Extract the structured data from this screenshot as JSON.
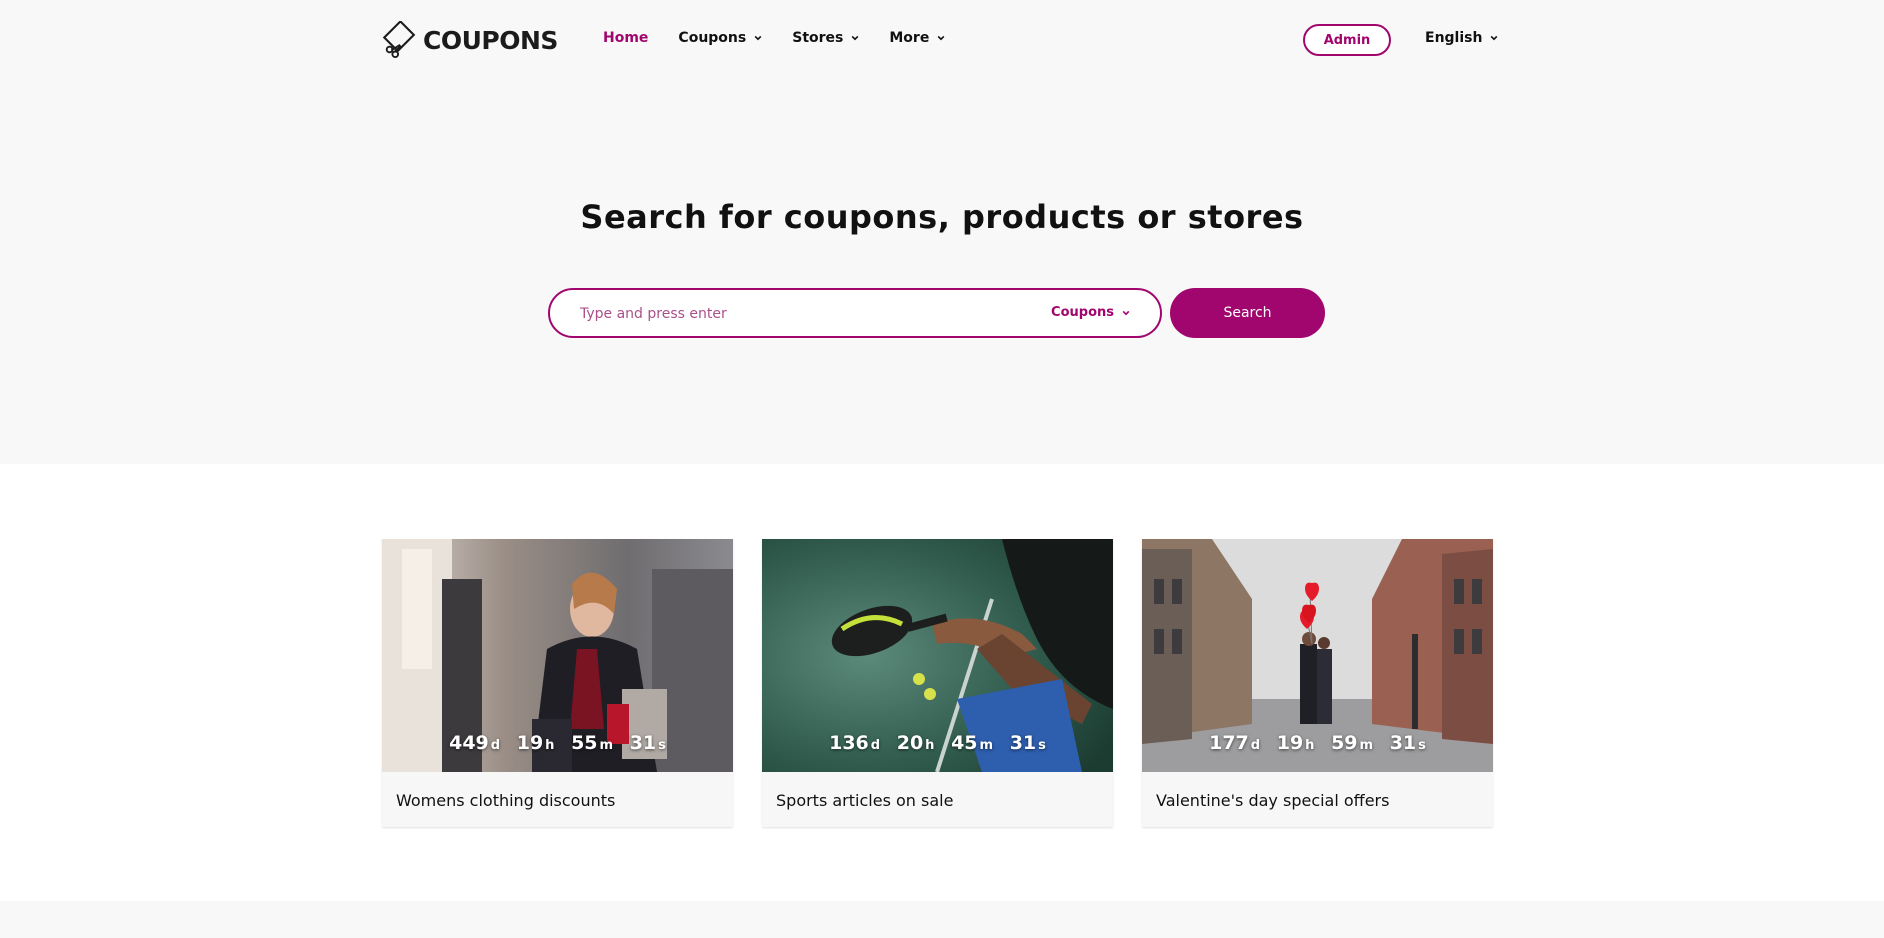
{
  "brand": {
    "name": "COUPONS",
    "accent": "#a0066e"
  },
  "nav": {
    "items": [
      {
        "label": "Home",
        "active": true,
        "has_dropdown": false
      },
      {
        "label": "Coupons",
        "active": false,
        "has_dropdown": true
      },
      {
        "label": "Stores",
        "active": false,
        "has_dropdown": true
      },
      {
        "label": "More",
        "active": false,
        "has_dropdown": true
      }
    ],
    "admin_label": "Admin",
    "language": "English"
  },
  "hero": {
    "title": "Search for coupons, products or stores",
    "search": {
      "placeholder": "Type and press enter",
      "type_selected": "Coupons",
      "button_label": "Search"
    }
  },
  "cards": [
    {
      "title": "Womens clothing discounts",
      "countdown": {
        "d": "449",
        "h": "19",
        "m": "55",
        "s": "31"
      },
      "image": "woman-shopping-photo"
    },
    {
      "title": "Sports articles on sale",
      "countdown": {
        "d": "136",
        "h": "20",
        "m": "45",
        "s": "31"
      },
      "image": "padel-racket-photo"
    },
    {
      "title": "Valentine's day special offers",
      "countdown": {
        "d": "177",
        "h": "19",
        "m": "59",
        "s": "31"
      },
      "image": "couple-street-balloons-photo"
    }
  ],
  "units": {
    "d": "d",
    "h": "h",
    "m": "m",
    "s": "s"
  }
}
